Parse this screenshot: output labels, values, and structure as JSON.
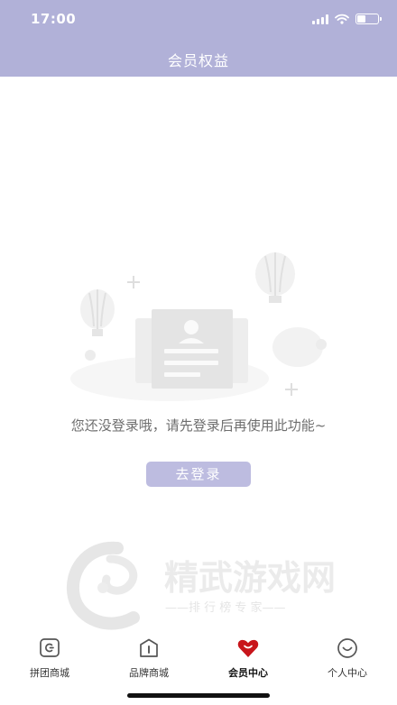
{
  "status_bar": {
    "time": "17:00"
  },
  "header": {
    "title": "会员权益"
  },
  "empty_state": {
    "message": "您还没登录哦，请先登录后再使用此功能~",
    "login_button": "去登录"
  },
  "watermark": {
    "brand": "精武游戏网",
    "tagline": "——排 行 榜 专 家——"
  },
  "tab_bar": {
    "tabs": [
      {
        "label": "拼团商城",
        "icon": "group-buy-icon",
        "active": false
      },
      {
        "label": "品牌商城",
        "icon": "brand-mall-icon",
        "active": false
      },
      {
        "label": "会员中心",
        "icon": "vip-heart-icon",
        "active": true
      },
      {
        "label": "个人中心",
        "icon": "profile-smile-icon",
        "active": false
      }
    ]
  },
  "colors": {
    "header_bg": "#b1b1d8",
    "button_bg": "#bdbce0",
    "active_icon": "#c8151b"
  }
}
